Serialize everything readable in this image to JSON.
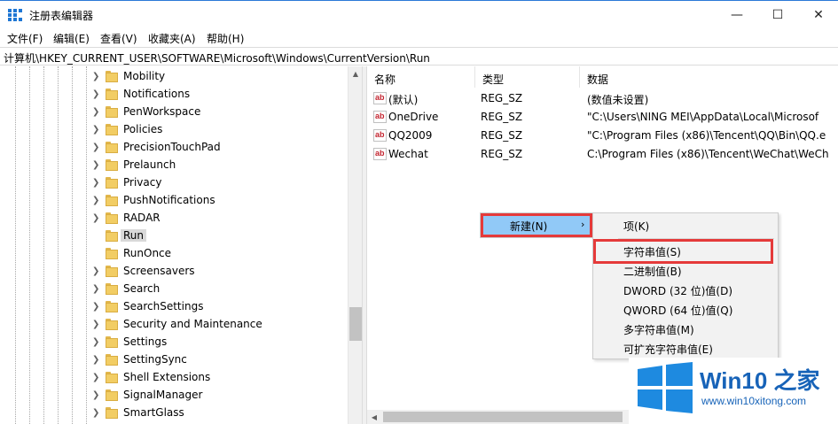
{
  "window": {
    "title": "注册表编辑器",
    "minimize_glyph": "—",
    "maximize_glyph": "☐",
    "close_glyph": "✕"
  },
  "menu": {
    "items": [
      "文件(F)",
      "编辑(E)",
      "查看(V)",
      "收藏夹(A)",
      "帮助(H)"
    ]
  },
  "address": {
    "path": "计算机\\HKEY_CURRENT_USER\\SOFTWARE\\Microsoft\\Windows\\CurrentVersion\\Run"
  },
  "tree": {
    "items": [
      {
        "label": "Mobility",
        "expandable": true
      },
      {
        "label": "Notifications",
        "expandable": true
      },
      {
        "label": "PenWorkspace",
        "expandable": true
      },
      {
        "label": "Policies",
        "expandable": true
      },
      {
        "label": "PrecisionTouchPad",
        "expandable": true
      },
      {
        "label": "Prelaunch",
        "expandable": true
      },
      {
        "label": "Privacy",
        "expandable": true
      },
      {
        "label": "PushNotifications",
        "expandable": true
      },
      {
        "label": "RADAR",
        "expandable": true
      },
      {
        "label": "Run",
        "expandable": false,
        "selected": true
      },
      {
        "label": "RunOnce",
        "expandable": false
      },
      {
        "label": "Screensavers",
        "expandable": true
      },
      {
        "label": "Search",
        "expandable": true
      },
      {
        "label": "SearchSettings",
        "expandable": true
      },
      {
        "label": "Security and Maintenance",
        "expandable": true
      },
      {
        "label": "Settings",
        "expandable": true
      },
      {
        "label": "SettingSync",
        "expandable": true
      },
      {
        "label": "Shell Extensions",
        "expandable": true
      },
      {
        "label": "SignalManager",
        "expandable": true
      },
      {
        "label": "SmartGlass",
        "expandable": true
      }
    ]
  },
  "values_pane": {
    "columns": [
      "名称",
      "类型",
      "数据"
    ],
    "rows": [
      {
        "name": "(默认)",
        "type": "REG_SZ",
        "data": "(数值未设置)"
      },
      {
        "name": "OneDrive",
        "type": "REG_SZ",
        "data": "\"C:\\Users\\NING MEI\\AppData\\Local\\Microsof"
      },
      {
        "name": "QQ2009",
        "type": "REG_SZ",
        "data": "\"C:\\Program Files (x86)\\Tencent\\QQ\\Bin\\QQ.e"
      },
      {
        "name": "Wechat",
        "type": "REG_SZ",
        "data": "C:\\Program Files (x86)\\Tencent\\WeChat\\WeCh"
      }
    ]
  },
  "context_menu": {
    "new_label": "新建(N)",
    "arrow_glyph": "›",
    "submenu": [
      "项(K)",
      "字符串值(S)",
      "二进制值(B)",
      "DWORD (32 位)值(D)",
      "QWORD (64 位)值(Q)",
      "多字符串值(M)",
      "可扩充字符串值(E)"
    ]
  },
  "watermark": {
    "title": "Win10 之家",
    "url": "www.win10xitong.com"
  },
  "colors": {
    "selection_blue": "#91c9f7",
    "highlight_red": "#e53a3a",
    "brand_blue": "#1763b8"
  }
}
